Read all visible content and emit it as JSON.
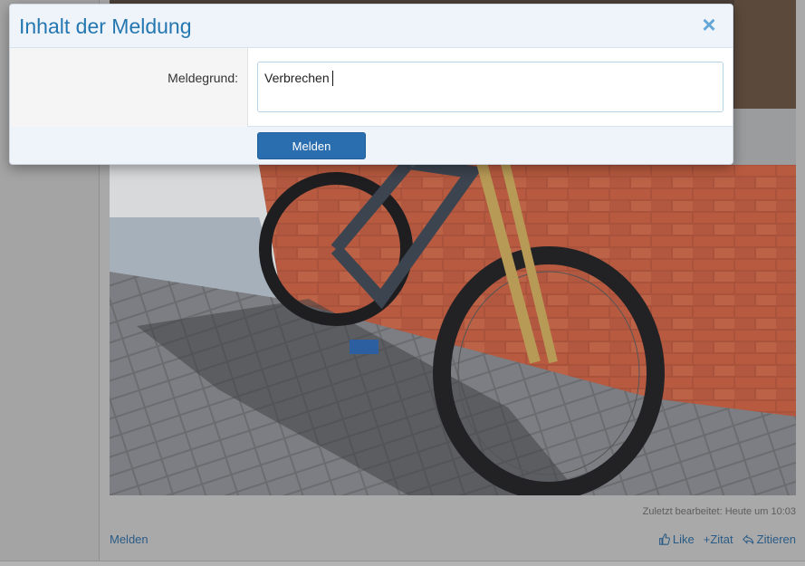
{
  "dialog": {
    "title": "Inhalt der Meldung",
    "close_glyph": "×",
    "field_label": "Meldegrund:",
    "field_value": "Verbrechen",
    "submit_label": "Melden"
  },
  "post": {
    "image_subject": "mountain bike leaning against brick wall",
    "edit_note": "Zuletzt bearbeitet: Heute um 10:03",
    "report_label": "Melden",
    "actions": [
      {
        "icon": "thumbs-up-icon",
        "label": "Like"
      },
      {
        "icon": "plus-icon",
        "label": "+Zitat"
      },
      {
        "icon": "reply-icon",
        "label": "Zitieren"
      }
    ]
  },
  "colors": {
    "accent": "#2577b1",
    "button": "#2b6eb0",
    "link": "#2a5b86"
  }
}
